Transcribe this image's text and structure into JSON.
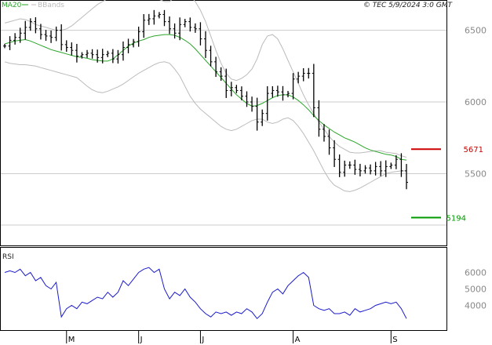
{
  "header": {
    "copyright": "© TEC 5/9/2024 3:0 GMT"
  },
  "legend": [
    {
      "label": "MA20",
      "color": "#2aa52a"
    },
    {
      "label": "BBands",
      "color": "#bbbbbb"
    }
  ],
  "colors": {
    "candle": "#000000",
    "ma20": "#2aa52a",
    "bbands": "#bbbbbb",
    "rsi": "#1a1acc",
    "resistance": "#cc0000",
    "support": "#009900",
    "grid": "#cccccc",
    "frame": "#000000"
  },
  "chart_data": [
    {
      "type": "line",
      "panel": "price",
      "title": "",
      "series": [
        {
          "name": "MA20",
          "values": [
            6405,
            6415,
            6425,
            6430,
            6435,
            6425,
            6410,
            6395,
            6380,
            6365,
            6355,
            6345,
            6335,
            6325,
            6315,
            6310,
            6305,
            6295,
            6290,
            6285,
            6285,
            6300,
            6330,
            6360,
            6390,
            6410,
            6425,
            6435,
            6450,
            6460,
            6465,
            6470,
            6470,
            6465,
            6450,
            6430,
            6405,
            6370,
            6330,
            6290,
            6250,
            6210,
            6170,
            6130,
            6090,
            6050,
            6020,
            5990,
            5970,
            5975,
            5990,
            6010,
            6030,
            6045,
            6050,
            6050,
            6035,
            6010,
            5980,
            5945,
            5905,
            5870,
            5840,
            5815,
            5790,
            5770,
            5750,
            5735,
            5720,
            5700,
            5680,
            5665,
            5655,
            5645,
            5635,
            5630,
            5620,
            5600,
            5595
          ]
        },
        {
          "name": "BBands upper",
          "values": [
            6550,
            6560,
            6570,
            6580,
            6575,
            6560,
            6540,
            6530,
            6520,
            6510,
            6500,
            6500,
            6510,
            6530,
            6560,
            6590,
            6620,
            6650,
            6680,
            6700,
            6720,
            6735,
            6745,
            6750,
            6755,
            6755,
            6755,
            6750,
            6740,
            6725,
            6715,
            6700,
            6700,
            6730,
            6760,
            6760,
            6740,
            6700,
            6640,
            6560,
            6460,
            6360,
            6270,
            6200,
            6160,
            6150,
            6165,
            6190,
            6230,
            6300,
            6400,
            6460,
            6470,
            6440,
            6370,
            6290,
            6210,
            6130,
            6050,
            5980,
            5920,
            5860,
            5810,
            5760,
            5720,
            5690,
            5670,
            5650,
            5645,
            5645,
            5650,
            5655,
            5660,
            5660,
            5650,
            5645,
            5640,
            5625,
            5615
          ]
        },
        {
          "name": "BBands lower",
          "values": [
            6280,
            6270,
            6265,
            6260,
            6260,
            6255,
            6250,
            6240,
            6230,
            6220,
            6210,
            6200,
            6190,
            6180,
            6170,
            6140,
            6110,
            6085,
            6070,
            6065,
            6075,
            6090,
            6105,
            6125,
            6150,
            6175,
            6200,
            6220,
            6240,
            6260,
            6275,
            6280,
            6270,
            6230,
            6180,
            6110,
            6040,
            5990,
            5950,
            5920,
            5890,
            5860,
            5830,
            5810,
            5800,
            5810,
            5830,
            5850,
            5870,
            5880,
            5880,
            5860,
            5850,
            5860,
            5880,
            5890,
            5870,
            5830,
            5780,
            5720,
            5660,
            5590,
            5520,
            5460,
            5420,
            5400,
            5380,
            5375,
            5385,
            5400,
            5420,
            5440,
            5460,
            5480,
            5500,
            5510,
            5515,
            5520,
            5520
          ]
        }
      ],
      "candles": [
        6390,
        6430,
        6450,
        6480,
        6520,
        6560,
        6510,
        6470,
        6460,
        6450,
        6500,
        6400,
        6380,
        6360,
        6320,
        6330,
        6340,
        6330,
        6310,
        6330,
        6340,
        6300,
        6330,
        6380,
        6400,
        6420,
        6490,
        6570,
        6580,
        6600,
        6610,
        6560,
        6510,
        6480,
        6540,
        6560,
        6520,
        6510,
        6440,
        6360,
        6280,
        6210,
        6180,
        6080,
        6100,
        6080,
        6040,
        6000,
        5970,
        5860,
        5920,
        6060,
        6080,
        6070,
        6050,
        6060,
        6160,
        6180,
        6200,
        6200,
        5960,
        5810,
        5760,
        5680,
        5600,
        5510,
        5560,
        5560,
        5530,
        5520,
        5540,
        5520,
        5550,
        5520,
        5550,
        5560,
        5600,
        5520,
        5440
      ],
      "ylim": [
        5000,
        6700
      ],
      "yticks": [
        5500,
        6000,
        6500
      ],
      "ytick_labels": [
        "5500",
        "6000",
        "6500"
      ],
      "levels": [
        {
          "name": "resistance",
          "value": 5671,
          "label": "5671"
        },
        {
          "name": "support",
          "value": 5194,
          "label": "5194"
        }
      ],
      "grid": true,
      "legend_position": "top-left"
    },
    {
      "type": "line",
      "panel": "indicator",
      "title": "RSI",
      "series": [
        {
          "name": "RSI",
          "values": [
            60,
            61,
            60,
            62,
            58,
            60,
            55,
            57,
            52,
            50,
            54,
            33,
            38,
            40,
            38,
            42,
            41,
            43,
            45,
            44,
            48,
            45,
            48,
            55,
            52,
            56,
            60,
            62,
            63,
            60,
            62,
            50,
            44,
            48,
            46,
            50,
            45,
            42,
            38,
            35,
            33,
            36,
            35,
            36,
            34,
            36,
            35,
            38,
            36,
            32,
            35,
            42,
            48,
            50,
            47,
            52,
            55,
            58,
            60,
            57,
            40,
            38,
            37,
            38,
            35,
            35,
            36,
            34,
            38,
            36,
            37,
            38,
            40,
            41,
            42,
            41,
            42,
            38,
            32
          ]
        }
      ],
      "ylim": [
        25,
        75
      ],
      "yticks": [
        40,
        50,
        60
      ],
      "ytick_labels": [
        "4000",
        "5000",
        "6000"
      ],
      "grid": false
    }
  ],
  "x_axis": {
    "month_labels": [
      {
        "label": "M",
        "index": 12
      },
      {
        "label": "J",
        "index": 26
      },
      {
        "label": "J",
        "index": 38
      },
      {
        "label": "A",
        "index": 56
      },
      {
        "label": "S",
        "index": 75
      }
    ]
  }
}
